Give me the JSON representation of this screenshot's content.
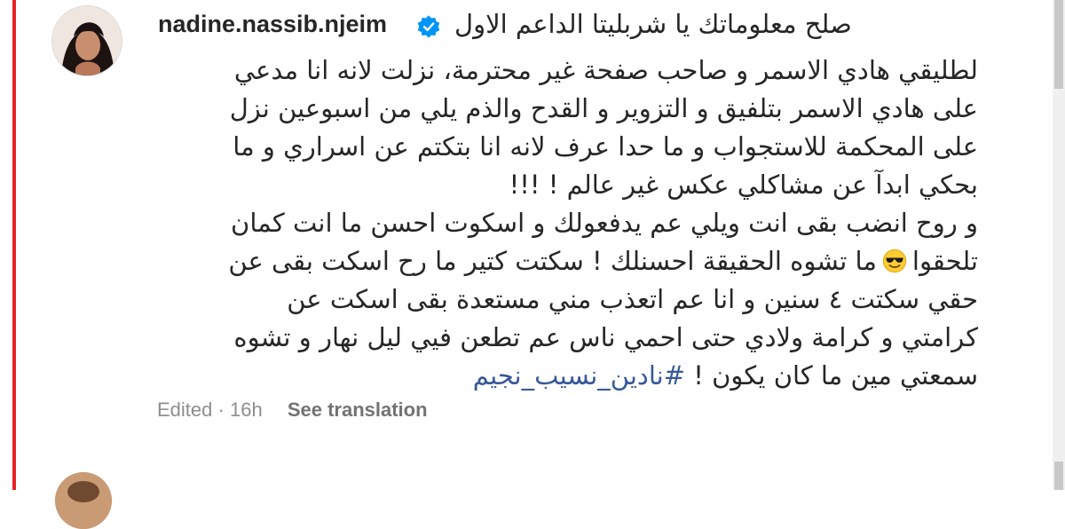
{
  "comment": {
    "username": "nadine.nassib.njeim",
    "verified": true,
    "lines": [
      "صلح معلوماتك يا شربليتا الداعم الاول",
      "لطليقي هادي الاسمر و صاحب صفحة غير محترمة، نزلت لانه انا مدعي",
      "على هادي الاسمر بتلفيق و التزوير و القدح والذم يلي من اسبوعين نزل",
      "على المحكمة للاستجواب و ما حدا عرف لانه انا بتكتم عن اسراري و ما",
      "بحكي ابدآ عن مشاكلي عكس غير عالم ! !!!",
      "و روح انضب بقى انت ويلي عم يدفعولك و اسكوت احسن ما انت كمان",
      "تلحقوا",
      "ما تشوه الحقيقة احسنلك ! سكتت كتير ما رح اسكت بقى عن",
      "حقي سكتت ٤ سنين و انا عم اتعذب مني مستعدة بقى اسكت عن",
      "كرامتي و كرامة ولادي حتى احمي ناس عم تطعن فيي ليل نهار و تشوه",
      "سمعتي مين ما كان يكون !",
      "#نادين_نسيب_نجيم"
    ],
    "emoji": "smiling-face-with-sunglasses",
    "meta": {
      "edited": "Edited",
      "separator": "·",
      "time": "16h",
      "see_translation": "See translation"
    }
  },
  "colors": {
    "accent_red": "#e32426",
    "verified_blue": "#0095f6",
    "hashtag": "#385898",
    "meta_gray": "#8e8e8e"
  }
}
